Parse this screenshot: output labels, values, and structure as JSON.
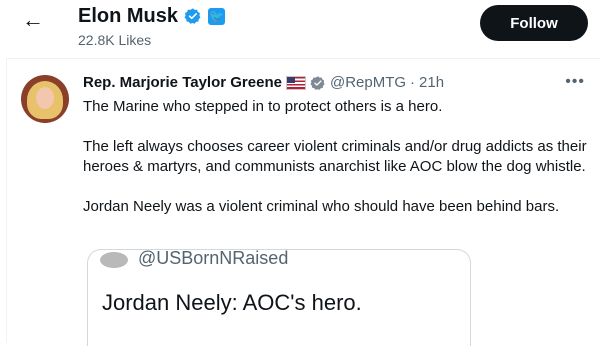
{
  "header": {
    "back_icon": "←",
    "title": "Elon Musk",
    "badge_icon": "verified-badge-icon",
    "likes_label": "22.8K Likes",
    "follow_label": "Follow"
  },
  "tweet": {
    "display_name": "Rep. Marjorie Taylor Greene",
    "flag_icon": "us-flag-icon",
    "handle": "@RepMTG",
    "time": "21h",
    "more_label": "•••",
    "text": "The Marine who stepped in to protect others is a hero.\n\nThe left always chooses career violent criminals and/or drug addicts as their heroes & martyrs, and communists anarchist like AOC blow the dog whistle.\n\nJordan Neely was a violent criminal who should have been behind bars."
  },
  "quote": {
    "handle": "@USBornNRaised",
    "text": "Jordan Neely: AOC's hero."
  },
  "colors": {
    "blue": "#1d9bf0",
    "text": "#0f1419",
    "gray": "#536471",
    "follow_bg": "#0f1419"
  }
}
